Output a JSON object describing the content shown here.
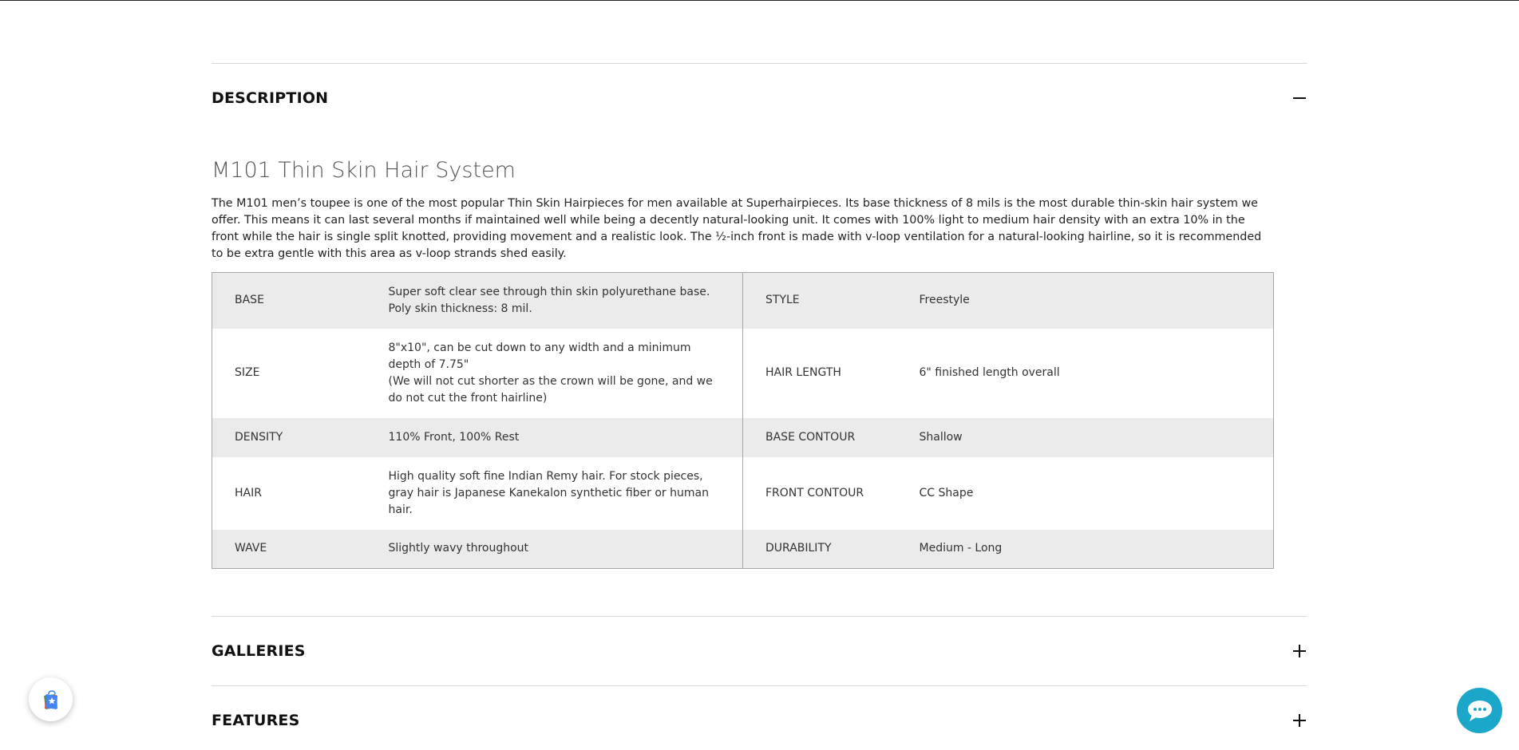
{
  "accordion": {
    "description": {
      "title": "DESCRIPTION",
      "state": "expanded"
    },
    "galleries": {
      "title": "GALLERIES",
      "state": "collapsed"
    },
    "features": {
      "title": "FEATURES",
      "state": "collapsed"
    }
  },
  "product": {
    "title": "M101 Thin Skin Hair System",
    "description": "The M101 men’s toupee is one of the most popular Thin Skin Hairpieces for men available at Superhairpieces. Its base thickness of 8 mils is the most durable thin-skin hair system we offer. This means it can last several months if maintained well while being a decently natural-looking unit. It comes with 100% light to medium hair density with an extra 10% in the front while the hair is single split knotted, providing movement and a realistic look. The ½-inch front is made with v-loop ventilation for a natural-looking hairline, so it is recommended to be extra gentle with this area as v-loop strands shed easily."
  },
  "specs": [
    {
      "k1": "BASE",
      "v1": [
        "Super soft clear see through thin skin polyurethane base. Poly skin thickness: 8 mil."
      ],
      "k2": "STYLE",
      "v2": "Freestyle"
    },
    {
      "k1": "SIZE",
      "v1": [
        "8\"x10\", can be cut down to any width and a minimum depth of 7.75\"",
        "(We will not cut shorter as the crown will be gone, and we do not cut the front hairline)"
      ],
      "k2": "HAIR LENGTH",
      "v2": "6\" finished length overall"
    },
    {
      "k1": "DENSITY",
      "v1": [
        "110% Front, 100% Rest"
      ],
      "k2": "BASE CONTOUR",
      "v2": "Shallow"
    },
    {
      "k1": "HAIR",
      "v1": [
        "High quality soft fine Indian Remy hair. For stock pieces, gray hair is Japanese Kanekalon synthetic fiber or human hair."
      ],
      "k2": "FRONT CONTOUR",
      "v2": "CC Shape"
    },
    {
      "k1": "WAVE",
      "v1": [
        "Slightly wavy throughout"
      ],
      "k2": "DURABILITY",
      "v2": "Medium - Long"
    }
  ],
  "widgets": {
    "badge_icon": "shopping-bag-star-icon",
    "chat_icon": "chat-bubble-icon",
    "chat_color": "#1aa7c9"
  }
}
